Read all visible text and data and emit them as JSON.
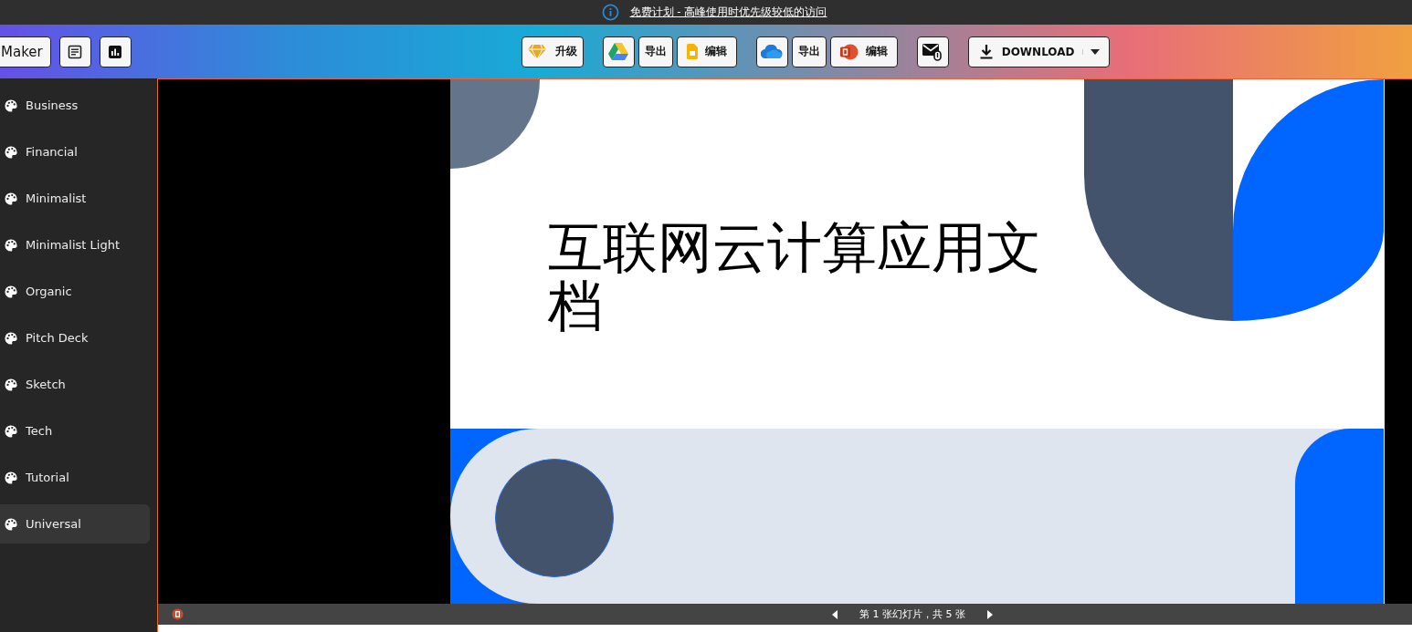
{
  "notice": {
    "text": "免费计划 - 高峰使用时优先级较低的访问"
  },
  "toolbar": {
    "maker_label": "Maker",
    "upgrade_label": "升级",
    "drive_group": [
      {
        "kind": "export",
        "label": "导出"
      },
      {
        "kind": "edit",
        "label": "编辑"
      }
    ],
    "onedrive_group": [
      {
        "kind": "export",
        "label": "导出"
      },
      {
        "kind": "edit",
        "label": "编辑"
      }
    ],
    "download_label": "DOWNLOAD"
  },
  "sidebar": {
    "items": [
      {
        "label": "Business",
        "selected": false
      },
      {
        "label": "Financial",
        "selected": false
      },
      {
        "label": "Minimalist",
        "selected": false
      },
      {
        "label": "Minimalist Light",
        "selected": false
      },
      {
        "label": "Organic",
        "selected": false
      },
      {
        "label": "Pitch Deck",
        "selected": false
      },
      {
        "label": "Sketch",
        "selected": false
      },
      {
        "label": "Tech",
        "selected": false
      },
      {
        "label": "Tutorial",
        "selected": false
      },
      {
        "label": "Universal",
        "selected": true
      }
    ]
  },
  "slide": {
    "title": "互联网云计算应用文档"
  },
  "viewer_footer": {
    "slide_counter": "第 1 张幻灯片，共 5 张"
  }
}
